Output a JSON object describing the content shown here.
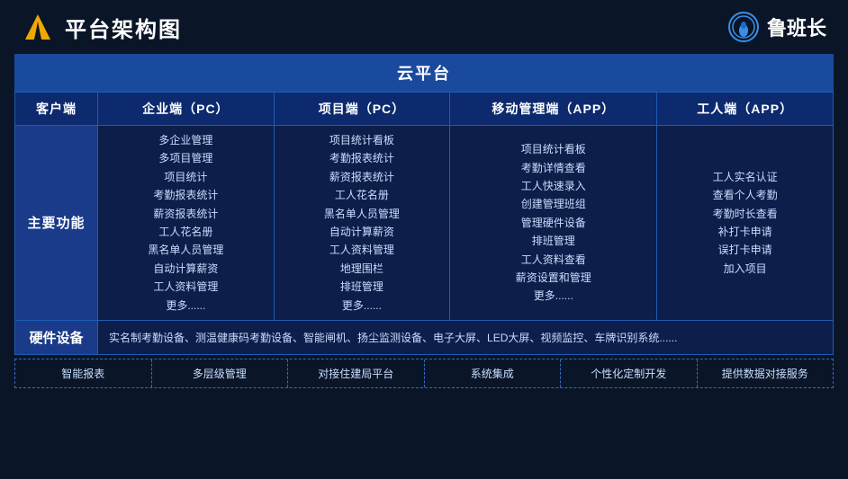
{
  "header": {
    "title": "平台架构图",
    "brand": "鲁班长"
  },
  "cloud": {
    "label": "云平台"
  },
  "columns": {
    "client": "客户端",
    "enterprise_pc": "企业端（PC）",
    "project_pc": "项目端（PC）",
    "mobile_app": "移动管理端（APP）",
    "worker_app": "工人端（APP）"
  },
  "rows": {
    "main_features": {
      "label": "主要功能",
      "enterprise_items": [
        "多企业管理",
        "多项目管理",
        "项目统计",
        "考勤报表统计",
        "薪资报表统计",
        "工人花名册",
        "黑名单人员管理",
        "自动计算薪资",
        "工人资料管理",
        "更多......"
      ],
      "project_items": [
        "项目统计看板",
        "考勤报表统计",
        "薪资报表统计",
        "工人花名册",
        "黑名单人员管理",
        "自动计算薪资",
        "工人资料管理",
        "地理围栏",
        "排班管理",
        "更多......"
      ],
      "mobile_items": [
        "项目统计看板",
        "考勤详情查看",
        "工人快速录入",
        "创建管理班组",
        "管理硬件设备",
        "排班管理",
        "工人资料查看",
        "薪资设置和管理",
        "更多......"
      ],
      "worker_items": [
        "工人实名认证",
        "查看个人考勤",
        "考勤时长查看",
        "补打卡申请",
        "误打卡申请",
        "加入项目"
      ]
    },
    "hardware": {
      "label": "硬件设备",
      "content": "实名制考勤设备、测温健康码考勤设备、智能闸机、扬尘监测设备、电子大屏、LED大屏、视频监控、车牌识别系统......"
    }
  },
  "bottom_features": [
    "智能报表",
    "多层级管理",
    "对接住建局平台",
    "系统集成",
    "个性化定制开发",
    "提供数据对接服务"
  ]
}
